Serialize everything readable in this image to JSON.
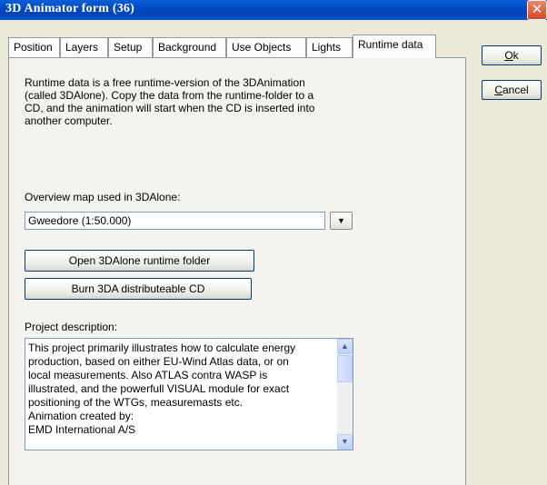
{
  "window": {
    "title": "3D Animator form   (36)",
    "close_glyph": "✕"
  },
  "tabs": [
    {
      "label": "Position",
      "active": false
    },
    {
      "label": "Layers",
      "active": false
    },
    {
      "label": "Setup",
      "active": false
    },
    {
      "label": "Background",
      "active": false
    },
    {
      "label": "Use Objects",
      "active": false
    },
    {
      "label": "Lights",
      "active": false
    },
    {
      "label": "Runtime data",
      "active": true
    }
  ],
  "runtime": {
    "description_lines": [
      "Runtime data is a free runtime-version of the 3DAnimation",
      "(called 3DAlone). Copy the data from the runtime-folder to a",
      "CD, and the animation will start when the CD is inserted into",
      "another computer."
    ],
    "overview_label": "Overview map used in 3DAlone:",
    "overview_value": "Gweedore (1:50.000)",
    "open_folder_button": "Open 3DAlone runtime folder",
    "burn_cd_button": "Burn 3DA distributeable CD",
    "project_label": "Project description:",
    "project_text": [
      "This project primarily illustrates how to calculate energy",
      "production, based on either EU-Wind Atlas data, or on",
      "local measurements. Also ATLAS contra WASP is",
      "illustrated, and the powerfull VISUAL module for exact",
      "positioning of the WTGs, measuremasts etc.",
      "Animation created by:",
      "EMD International A/S"
    ]
  },
  "buttons": {
    "ok": {
      "mnemonic": "O",
      "rest": "k"
    },
    "cancel": {
      "mnemonic": "C",
      "rest": "ancel"
    }
  },
  "icons": {
    "dropdown": "▼",
    "scroll_up": "▲",
    "scroll_down": "▼"
  }
}
